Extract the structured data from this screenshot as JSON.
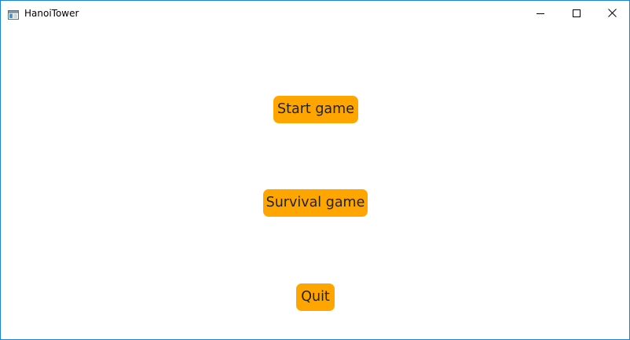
{
  "window": {
    "title": "HanoiTower",
    "app_icon": "window-app-icon",
    "controls": {
      "minimize_icon": "minimize-icon",
      "maximize_icon": "maximize-icon",
      "close_icon": "close-icon"
    }
  },
  "menu": {
    "start_label": "Start game",
    "survival_label": "Survival game",
    "quit_label": "Quit"
  },
  "colors": {
    "button_background": "#ffa500",
    "button_text": "#222222",
    "window_border": "#1883d7",
    "background": "#ffffff"
  }
}
